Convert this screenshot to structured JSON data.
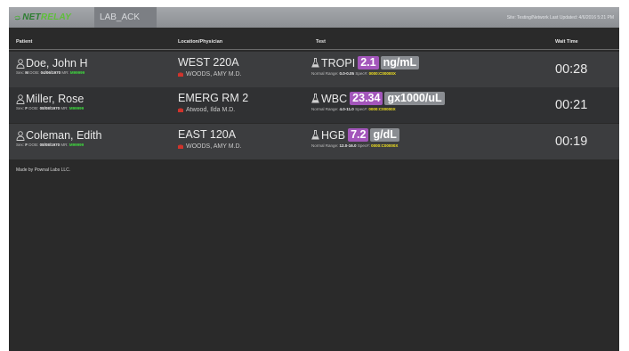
{
  "app": {
    "logo_net": "NET",
    "logo_relay": "RELAY",
    "tab_label": "LAB_ACK",
    "site_info": "Site: Testing/Network Last Updated: 4/6/2016 5:21 PM"
  },
  "columns": {
    "patient": "Patient",
    "location": "Location/Physician",
    "test": "Test",
    "wait": "Wait Time"
  },
  "labels": {
    "sex": "Sex:",
    "dob": "DOB:",
    "mr": "MR:",
    "normal_range": "Normal Range:",
    "spec": "Spec#:"
  },
  "rows": [
    {
      "name": "Doe, John H",
      "sex": "M",
      "dob": "04/06/1970",
      "mrn": "M99999",
      "location": "WEST 220A",
      "physician": "WOODS, AMY M.D.",
      "test": "TROPI",
      "value": "2.1",
      "unit": "ng/mL",
      "normal_range": "0.0-0.05",
      "spec": "0000:C00000X",
      "wait": "00:28"
    },
    {
      "name": "Miller, Rose",
      "sex": "F",
      "dob": "08/08/1970",
      "mrn": "M99999",
      "location": "EMERG RM 2",
      "physician": "Atwood, Ilda M.D.",
      "test": "WBC",
      "value": "23.34",
      "unit": "gx1000/uL",
      "normal_range": "4.0-11.0",
      "spec": "0000:C00000X",
      "wait": "00:21"
    },
    {
      "name": "Coleman, Edith",
      "sex": "F",
      "dob": "08/08/1970",
      "mrn": "M99999",
      "location": "EAST 120A",
      "physician": "WOODS, AMY M.D.",
      "test": "HGB",
      "value": "7.2",
      "unit": "g/dL",
      "normal_range": "12.0-16.0",
      "spec": "0000:C00000X",
      "wait": "00:19"
    }
  ],
  "footer": "Made by Pownal Labs LLC.",
  "colors": {
    "value_badge": "#a356bb",
    "unit_badge": "#8a8d92",
    "mrn": "#3fdc3f",
    "spec": "#f0e020",
    "physician_icon": "#d0342c"
  },
  "icons": {
    "patient": "person-icon",
    "physician": "briefcase-icon",
    "test": "flask-icon",
    "logo": "relay-arrows-icon"
  }
}
